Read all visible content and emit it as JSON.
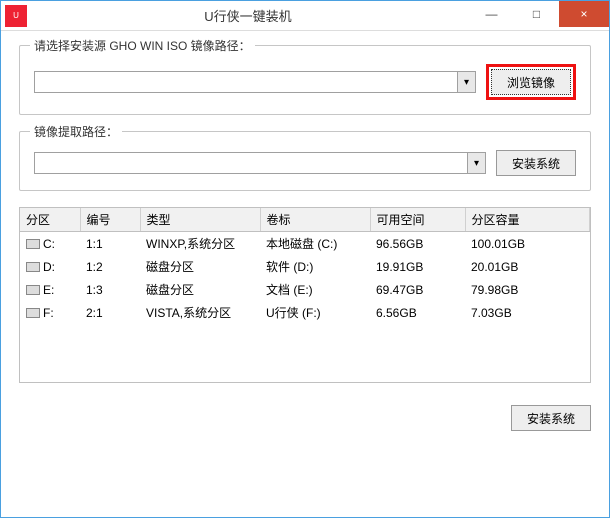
{
  "window": {
    "title": "U行侠一键装机",
    "minimize": "—",
    "maximize": "□",
    "close": "×"
  },
  "source": {
    "legend": "请选择安装源 GHO WIN ISO 镜像路径：",
    "value": "",
    "browse": "浏览镜像"
  },
  "extract": {
    "legend": "镜像提取路径：",
    "value": "",
    "install": "安装系统"
  },
  "table": {
    "headers": {
      "partition": "分区",
      "number": "编号",
      "type": "类型",
      "volume": "卷标",
      "free": "可用空间",
      "capacity": "分区容量"
    },
    "rows": [
      {
        "partition": "C:",
        "number": "1:1",
        "type": "WINXP,系统分区",
        "volume": "本地磁盘 (C:)",
        "free": "96.56GB",
        "capacity": "100.01GB"
      },
      {
        "partition": "D:",
        "number": "1:2",
        "type": "磁盘分区",
        "volume": "软件 (D:)",
        "free": "19.91GB",
        "capacity": "20.01GB"
      },
      {
        "partition": "E:",
        "number": "1:3",
        "type": "磁盘分区",
        "volume": "文档 (E:)",
        "free": "69.47GB",
        "capacity": "79.98GB"
      },
      {
        "partition": "F:",
        "number": "2:1",
        "type": "VISTA,系统分区",
        "volume": "U行侠 (F:)",
        "free": "6.56GB",
        "capacity": "7.03GB"
      }
    ]
  },
  "footer": {
    "install": "安装系统"
  }
}
